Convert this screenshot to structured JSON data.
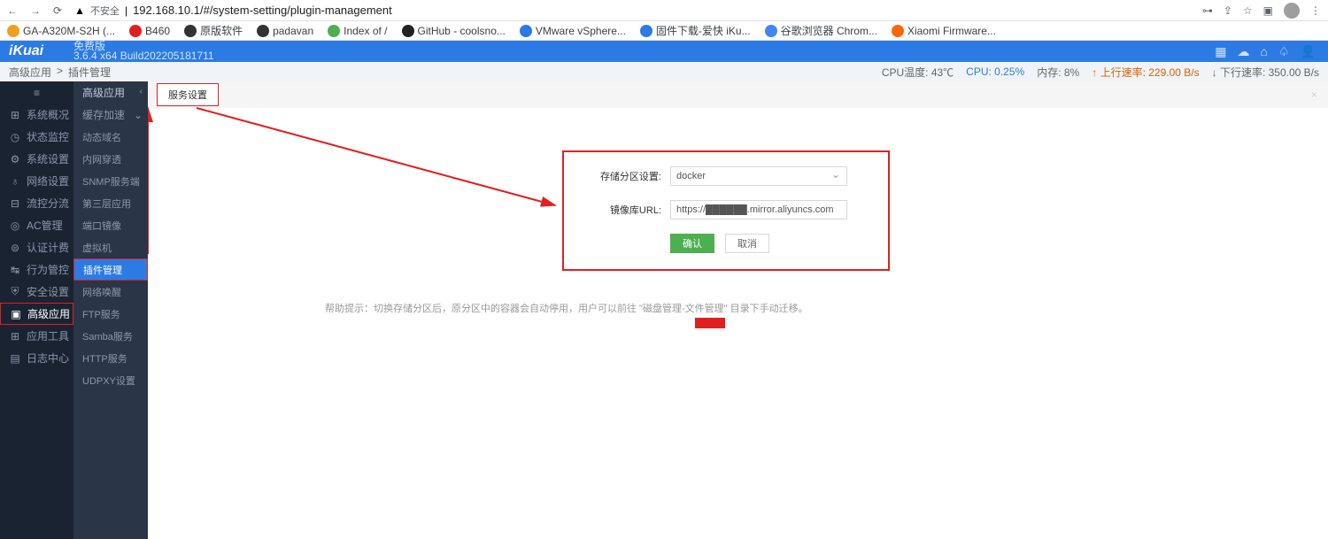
{
  "browser": {
    "insecure_label": "不安全",
    "url": "192.168.10.1/#/system-setting/plugin-management",
    "bookmarks": [
      "GA-A320M-S2H (...",
      "B460",
      "原版软件",
      "padavan",
      "Index of /",
      "GitHub - coolsno...",
      "VMware vSphere...",
      "固件下载-爱快 iKu...",
      "谷歌浏览器 Chrom...",
      "Xiaomi Firmware..."
    ]
  },
  "header": {
    "logo": "iKuai",
    "edition": "免费版",
    "version": "3.6.4 x64 Build202205181711"
  },
  "status": {
    "breadcrumb1": "高级应用",
    "breadcrumb2": "插件管理",
    "cpu_temp": "CPU温度: 43℃",
    "cpu": "CPU: 0.25%",
    "mem": "内存: 8%",
    "up": "上行速率: 229.00 B/s",
    "down": "下行速率: 350.00 B/s"
  },
  "sidebar1": {
    "title": "高级应用",
    "items": [
      "系统概况",
      "状态监控",
      "系统设置",
      "网络设置",
      "流控分流",
      "AC管理",
      "认证计费",
      "行为管控",
      "安全设置",
      "高级应用",
      "应用工具",
      "日志中心"
    ]
  },
  "sidebar2": {
    "title": "缓存加速",
    "items": [
      "动态域名",
      "内网穿透",
      "SNMP服务端",
      "第三层应用",
      "端口镜像",
      "虚拟机",
      "插件管理",
      "网络唤醒",
      "FTP服务",
      "Samba服务",
      "HTTP服务",
      "UDPXY设置"
    ]
  },
  "tab": {
    "label": "服务设置"
  },
  "form": {
    "storage_label": "存储分区设置:",
    "storage_value": "docker",
    "url_label": "镜像库URL:",
    "url_prefix": "https://",
    "url_suffix": ".mirror.aliyuncs.com",
    "ok": "确认",
    "cancel": "取消"
  },
  "hint": "帮助提示：切换存储分区后，原分区中的容器会自动停用，用户可以前往 \"磁盘管理-文件管理\" 目录下手动迁移。"
}
